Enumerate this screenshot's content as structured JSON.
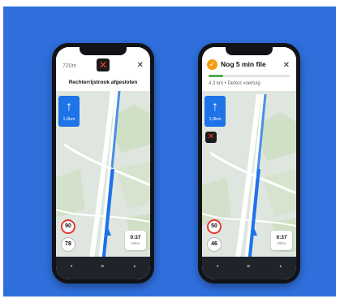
{
  "left_phone": {
    "distance_small": "720m",
    "close_symbol": "✕",
    "stop_symbol": "✕",
    "alert_title": "Rechterrijstrook afgesloten",
    "turn": {
      "arrow": "↑",
      "distance": "1,0km"
    },
    "speed_limit": "90",
    "current_speed": "78",
    "eta": {
      "time": "0:37",
      "remaining": "59km"
    },
    "nav_icons": [
      "•",
      "≡",
      "▪"
    ]
  },
  "right_phone": {
    "traffic_symbol": "✓",
    "traffic_title": "Nog 5 min file",
    "close_symbol": "✕",
    "progress": 0.18,
    "subtitle": "4,3 km • Defect voertuig",
    "turn": {
      "arrow": "↑",
      "distance": "1,0km"
    },
    "report_symbol": "✕",
    "speed_limit": "50",
    "current_speed": "46",
    "eta": {
      "time": "0:37",
      "remaining": "59km"
    },
    "nav_icons": [
      "•",
      "≡",
      "▪"
    ]
  },
  "colors": {
    "background": "#2f6fdc",
    "turn_card": "#1e73e8",
    "speed_border": "#e53935",
    "traffic_badge": "#f39c12",
    "progress": "#4caf50"
  }
}
